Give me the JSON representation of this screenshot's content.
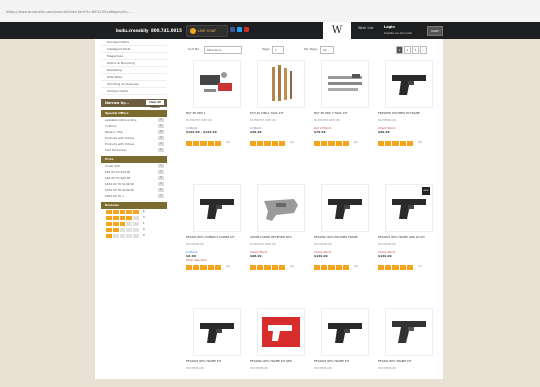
{
  "browser": {
    "url": "https://www.brownells.com/search/index.htm?k=80%25&categoryId=..."
  },
  "topbar": {
    "brand": "bsdu.crossbily",
    "phone": "800.741.0015",
    "chat_label": "LIVE CHAT",
    "login_label": "Wish List",
    "account_label": "Login",
    "account_sub": "Create an Account",
    "cart_label": "CART",
    "cart_count": "0"
  },
  "sidebar": {
    "categories": [
      "Handgun Parts",
      "Intelligent Parts",
      "Magazines",
      "Optics & Mounting",
      "Reloading",
      "Rifle Parts",
      "Shooting Accessories",
      "Shotgun Parts"
    ],
    "narrow_title": "Narrow by...",
    "narrow_btn": "Clear All Filters",
    "special_title": "Special Offers",
    "special": [
      {
        "label": "Available Options Only",
        "count": "2"
      },
      {
        "label": "In Stock",
        "count": "2"
      },
      {
        "label": "Made in USA",
        "count": "8"
      },
      {
        "label": "Products with Videos",
        "count": "4"
      },
      {
        "label": "Products with Videos",
        "count": "4"
      },
      {
        "label": "Sold Exclusives",
        "count": "1"
      }
    ],
    "price_title": "Price",
    "prices": [
      {
        "label": "Under $25",
        "count": "1"
      },
      {
        "label": "$25.00 TO $49.99",
        "count": "3"
      },
      {
        "label": "$50.00 TO $99.99",
        "count": "6"
      },
      {
        "label": "$100.00 TO $149.99",
        "count": "4"
      },
      {
        "label": "$150.00 TO $199.99",
        "count": "2"
      },
      {
        "label": "$200.00 TO +",
        "count": "1"
      }
    ],
    "reviews_title": "Reviews",
    "reviews": [
      {
        "stars": 5,
        "count": "6"
      },
      {
        "stars": 4,
        "count": "3"
      },
      {
        "stars": 3,
        "count": "1"
      },
      {
        "stars": 2,
        "count": "0"
      },
      {
        "stars": 1,
        "count": "0"
      }
    ]
  },
  "sortbar": {
    "sort_label": "Sort By:",
    "sort_value": "Relevance",
    "page_label": "Page:",
    "page_value": "1",
    "per_page_label": "Per Page:",
    "per_page_value": "24",
    "pages": [
      "1",
      "2",
      "3",
      "›"
    ]
  },
  "products": [
    {
      "name": "BUY 80 PRO 1",
      "sub": "80 PERCENT ARMS INC.",
      "stock": "In Stock",
      "stock_color": "#2a6dc0",
      "price": "$129.99 - $149.99",
      "price2": "",
      "stars": 5,
      "reviews": "(3)",
      "art": "kit"
    },
    {
      "name": "EVO JIG DRILL TOOL KIT",
      "sub": "80 PERCENT ARMS INC.",
      "stock": "In Stock",
      "stock_color": "#2a6dc0",
      "price": "$48.99",
      "price2": "",
      "stars": 5,
      "reviews": "(2)",
      "art": "drills"
    },
    {
      "name": "BUY 80 PRO 3 TOOL KIT",
      "sub": "80 PERCENT ARMS INC.",
      "stock": "Out of Stock",
      "stock_color": "#c0392b",
      "price": "$79.99",
      "price2": "",
      "stars": 5,
      "reviews": "(1)",
      "art": "bits"
    },
    {
      "name": "FINISHED POLYMER 80 FRAME",
      "sub": "POLYMER80 INC.",
      "stock": "Check Stock",
      "stock_color": "#c0392b",
      "price": "$99.99",
      "price2": "",
      "stars": 5,
      "reviews": "(9)",
      "art": "frame"
    },
    {
      "name": "PF940C 80% COMPACT LOWER KIT",
      "sub": "POLYMER80 INC.",
      "stock": "In Stock",
      "stock_color": "#2a6dc0",
      "price": "$X.XX",
      "price2": "Other Sale Price",
      "stars": 5,
      "reviews": "(4)",
      "art": "frame"
    },
    {
      "name": "AR308 LOWER RECEIVER 80%",
      "sub": "80 PERCENT ARMS INC.",
      "stock": "Check Stock",
      "stock_color": "#c0392b",
      "price": "$98.99",
      "price2": "",
      "stars": 5,
      "reviews": "(2)",
      "art": "receiver"
    },
    {
      "name": "PF940SC 80% POLYMER FRAME",
      "sub": "POLYMER80 INC.",
      "stock": "Check Stock",
      "stock_color": "#c0392b",
      "price": "$149.99",
      "price2": "",
      "stars": 5,
      "reviews": "(5)",
      "art": "frame"
    },
    {
      "name": "PF940V2 80% FRAME AND JIG KIT",
      "sub": "POLYMER80 INC.",
      "stock": "Check Stock",
      "stock_color": "#c0392b",
      "price": "$149.99",
      "price2": "",
      "stars": 5,
      "reviews": "(7)",
      "art": "frame"
    },
    {
      "name": "PF940V2 80% FRAME KIT",
      "sub": "POLYMER80 INC.",
      "stock": "",
      "stock_color": "#2a6dc0",
      "price": "",
      "price2": "",
      "stars": 0,
      "reviews": "",
      "art": "frame"
    },
    {
      "name": "PF940SC 80% FRAME KIT RED",
      "sub": "POLYMER80 INC.",
      "stock": "",
      "stock_color": "#2a6dc0",
      "price": "",
      "price2": "",
      "stars": 0,
      "reviews": "",
      "art": "redframe"
    },
    {
      "name": "PF940V2 80% FRAME KIT",
      "sub": "POLYMER80 INC.",
      "stock": "",
      "stock_color": "#2a6dc0",
      "price": "",
      "price2": "",
      "stars": 0,
      "reviews": "",
      "art": "frame"
    },
    {
      "name": "PF940C 80% FRAME KIT",
      "sub": "POLYMER80 INC.",
      "stock": "",
      "stock_color": "#2a6dc0",
      "price": "",
      "price2": "",
      "stars": 0,
      "reviews": "",
      "art": "pistol"
    }
  ],
  "colors": {
    "rating": "#f4a51c",
    "panel": "#6e5c3f",
    "panel_green": "#7b6b2e"
  }
}
